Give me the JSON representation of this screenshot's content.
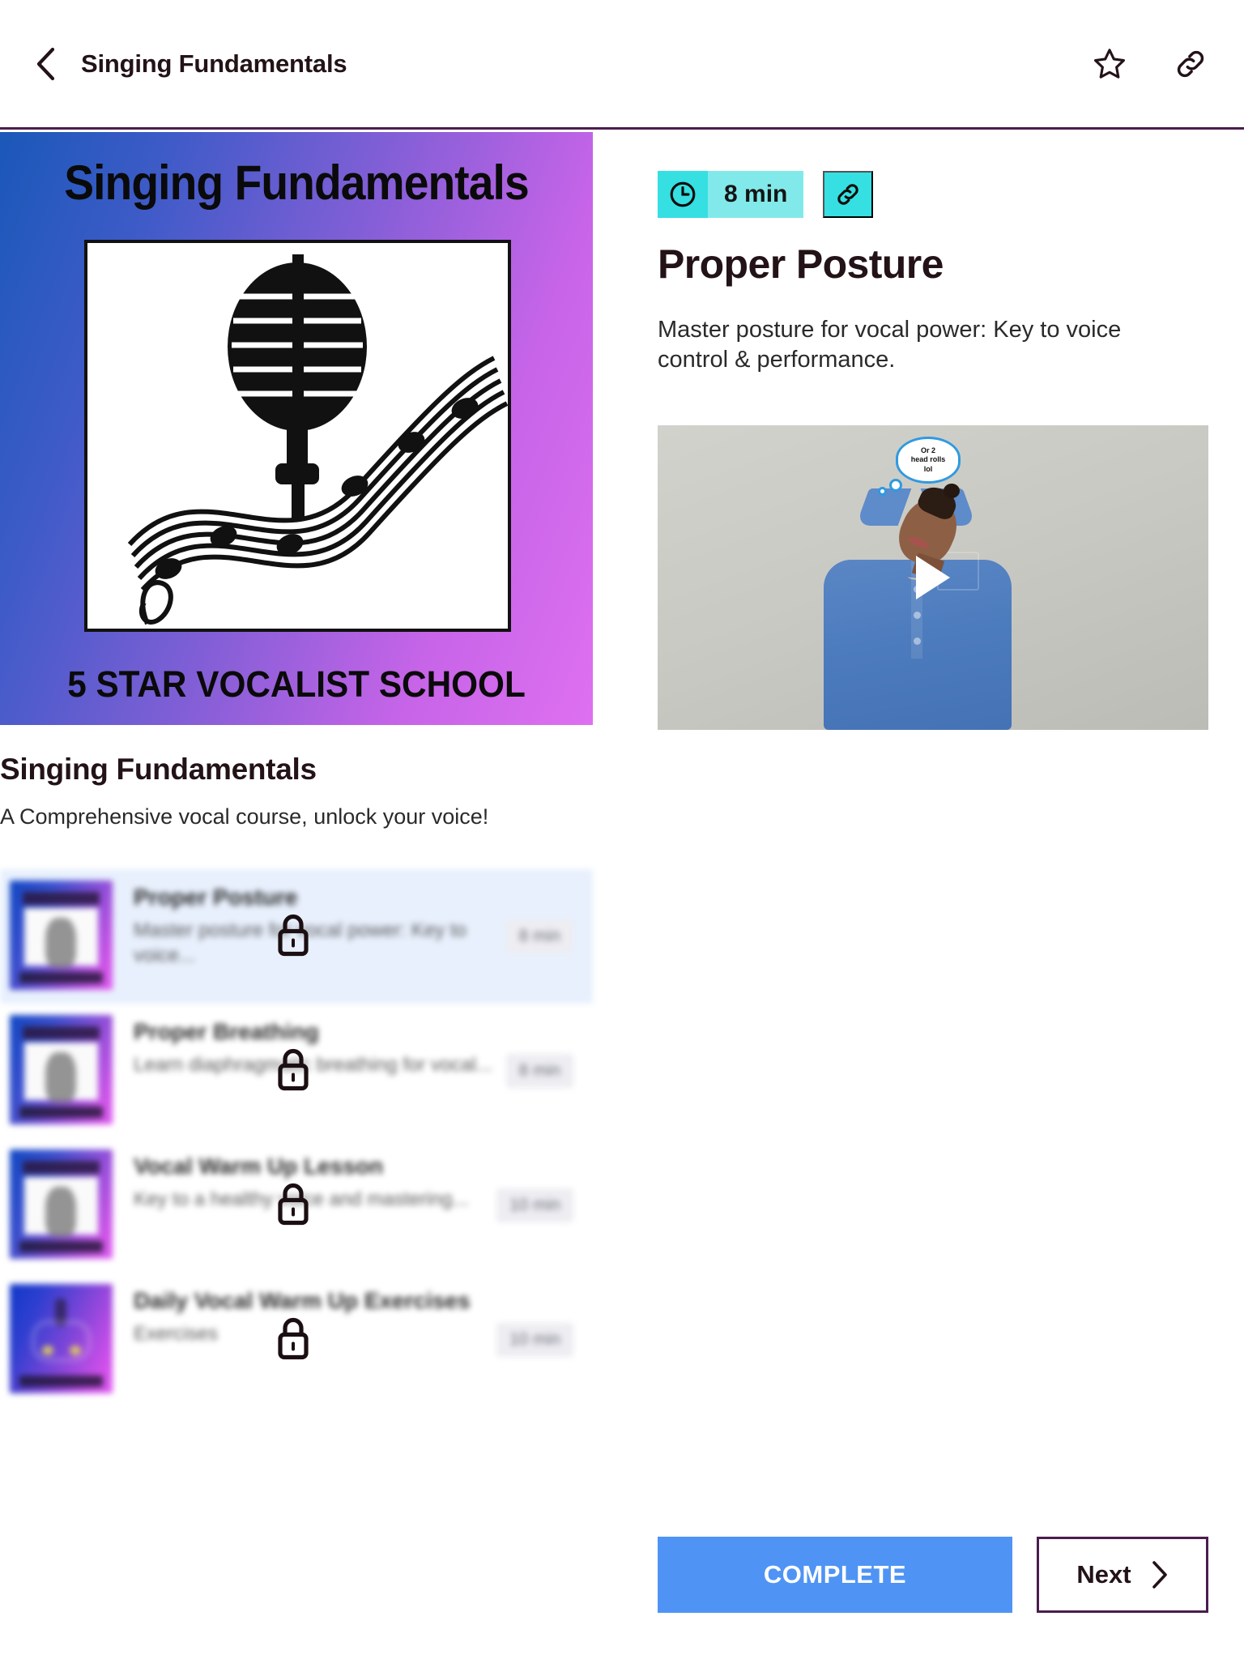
{
  "header": {
    "title": "Singing Fundamentals",
    "back_icon": "chevron-left-icon",
    "favorite_icon": "star-outline-icon",
    "share_icon": "link-icon"
  },
  "course": {
    "cover": {
      "title": "Singing Fundamentals",
      "subtitle": "5 STAR VOCALIST SCHOOL",
      "art_icon": "microphone-music-staff-illustration"
    },
    "title": "Singing Fundamentals",
    "description": "A Comprehensive vocal course, unlock your voice!"
  },
  "lessons": [
    {
      "name": "Proper Posture",
      "description": "Master posture for vocal power: Key to voice...",
      "duration": "8 min",
      "locked": true,
      "active": true,
      "lock_icon": "lock-icon"
    },
    {
      "name": "Proper Breathing",
      "description": "Learn diaphragmatic breathing for vocal...",
      "duration": "8 min",
      "locked": true,
      "active": false,
      "lock_icon": "lock-icon"
    },
    {
      "name": "Vocal Warm Up Lesson",
      "description": "Key to a healthy voice and mastering...",
      "duration": "10 min",
      "locked": true,
      "active": false,
      "lock_icon": "lock-icon"
    },
    {
      "name": "Daily Vocal Warm Up Exercises",
      "description": "Exercises",
      "duration": "10 min",
      "locked": true,
      "active": false,
      "lock_icon": "lock-icon"
    }
  ],
  "detail": {
    "duration": "8 min",
    "clock_icon": "clock-icon",
    "link_icon": "link-icon",
    "title": "Proper Posture",
    "description": "Master posture for vocal power: Key to voice\ncontrol & performance.",
    "video": {
      "play_icon": "play-icon",
      "thought_bubble": "Or 2\nhead rolls\nlol"
    }
  },
  "footer": {
    "complete_label": "COMPLETE",
    "next_label": "Next",
    "next_icon": "chevron-right-icon"
  },
  "colors": {
    "accent_cyan_dark": "#35dfe2",
    "accent_cyan_light": "#82e9ea",
    "complete_blue": "#4f94f4",
    "border_purple": "#4b1d4d",
    "active_row": "#e8f0fd"
  }
}
